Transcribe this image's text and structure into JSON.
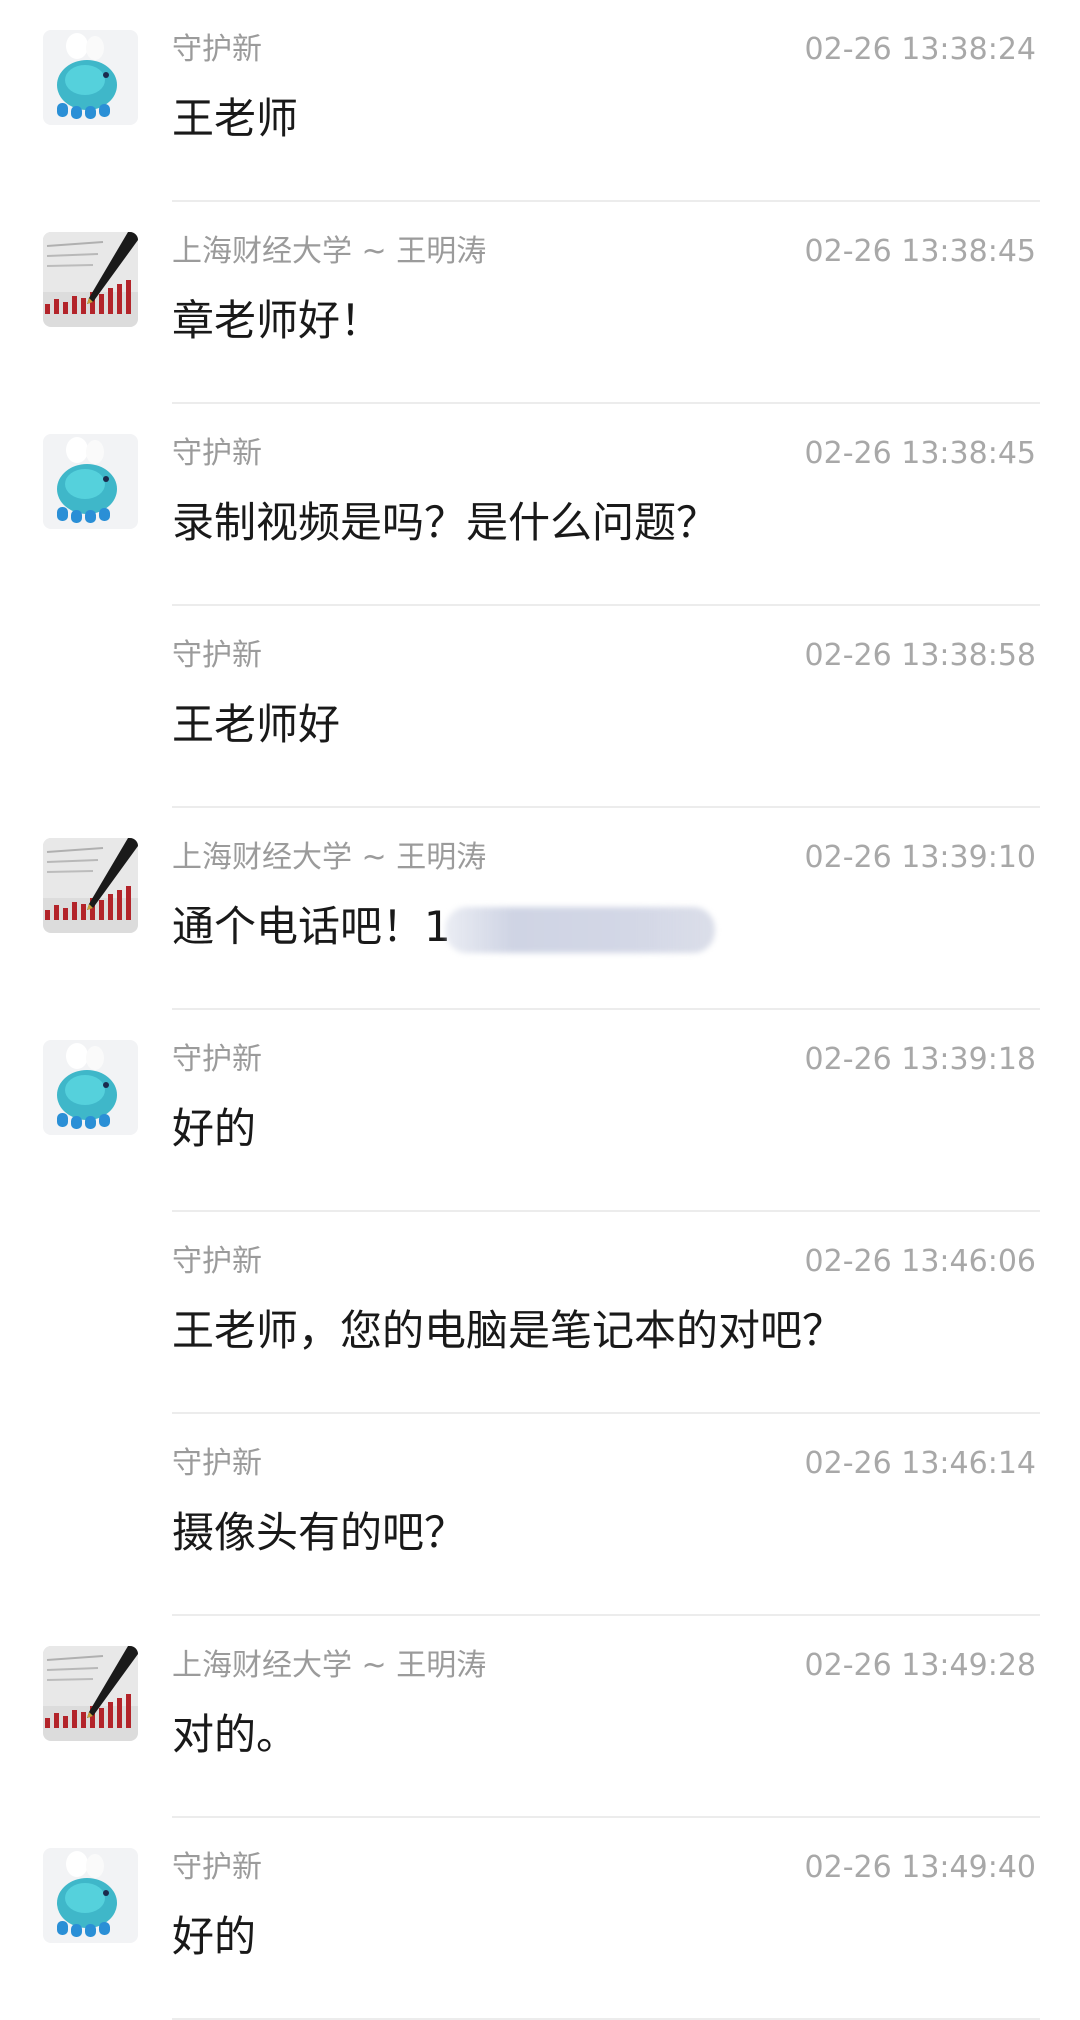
{
  "messages": [
    {
      "sender": "守护新",
      "time": "02-26 13:38:24",
      "text": "王老师",
      "avatar": "blue-toy-avatar"
    },
    {
      "sender": "上海财经大学 ~ 王明涛",
      "time": "02-26 13:38:45",
      "text": "章老师好！",
      "avatar": "pen-chart-avatar"
    },
    {
      "sender": "守护新",
      "time": "02-26 13:38:45",
      "text": "录制视频是吗？是什么问题？",
      "avatar": "blue-toy-avatar"
    },
    {
      "sender": "守护新",
      "time": "02-26 13:38:58",
      "text": "王老师好",
      "avatar": ""
    },
    {
      "sender": "上海财经大学 ~ 王明涛",
      "time": "02-26 13:39:10",
      "text": "通个电话吧！",
      "phone_visible": "1",
      "avatar": "pen-chart-avatar"
    },
    {
      "sender": "守护新",
      "time": "02-26 13:39:18",
      "text": "好的",
      "avatar": "blue-toy-avatar"
    },
    {
      "sender": "守护新",
      "time": "02-26 13:46:06",
      "text": "王老师，您的电脑是笔记本的对吧？",
      "avatar": ""
    },
    {
      "sender": "守护新",
      "time": "02-26 13:46:14",
      "text": "摄像头有的吧？",
      "avatar": ""
    },
    {
      "sender": "上海财经大学 ~ 王明涛",
      "time": "02-26 13:49:28",
      "text": "对的。",
      "avatar": "pen-chart-avatar"
    },
    {
      "sender": "守护新",
      "time": "02-26 13:49:40",
      "text": "好的",
      "avatar": "blue-toy-avatar"
    }
  ],
  "colors": {
    "sender": "#9b9b9b",
    "time": "#a8a8a8",
    "text": "#191919",
    "divider": "#ececec"
  }
}
